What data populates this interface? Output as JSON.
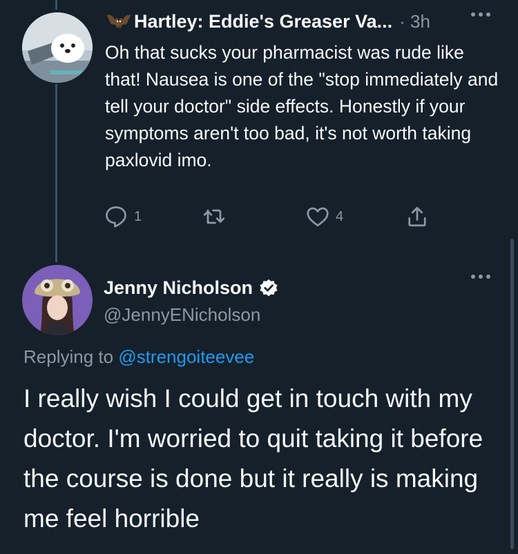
{
  "reply": {
    "author_name": "Hartley: Eddie's Greaser Va...",
    "separator": "·",
    "time": "3h",
    "text": "Oh that sucks your pharmacist was rude like that! Nausea is one of the \"stop immediately and tell your doctor\" side effects. Honestly if your symptoms aren't too bad, it's not worth taking paxlovid imo.",
    "actions": {
      "reply_count": "1",
      "retweet_count": "",
      "like_count": "4"
    }
  },
  "tweet": {
    "author_name": "Jenny Nicholson",
    "handle": "@JennyENicholson",
    "replying_prefix": "Replying to",
    "replying_to": "@strengoiteevee",
    "text": "I really wish I could get in touch with my doctor. I'm worried to quit taking it before the course is done but it really is making me feel horrible"
  },
  "colors": {
    "background": "#15202b",
    "text": "#f7f9f9",
    "muted": "#8b98a5",
    "link": "#1d9bf0"
  }
}
